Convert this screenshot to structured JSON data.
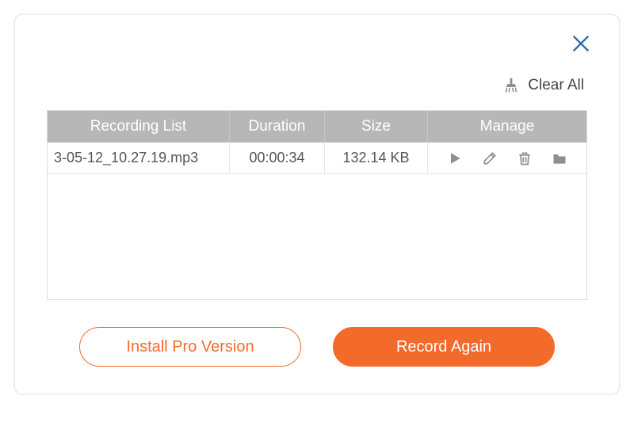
{
  "actions": {
    "clear_all": "Clear All"
  },
  "table": {
    "headers": {
      "name": "Recording List",
      "duration": "Duration",
      "size": "Size",
      "manage": "Manage"
    },
    "rows": [
      {
        "name": "3-05-12_10.27.19.mp3",
        "duration": "00:00:34",
        "size": "132.14 KB"
      }
    ]
  },
  "footer": {
    "install_pro": "Install Pro Version",
    "record_again": "Record Again"
  },
  "colors": {
    "accent": "#f36b2a"
  }
}
